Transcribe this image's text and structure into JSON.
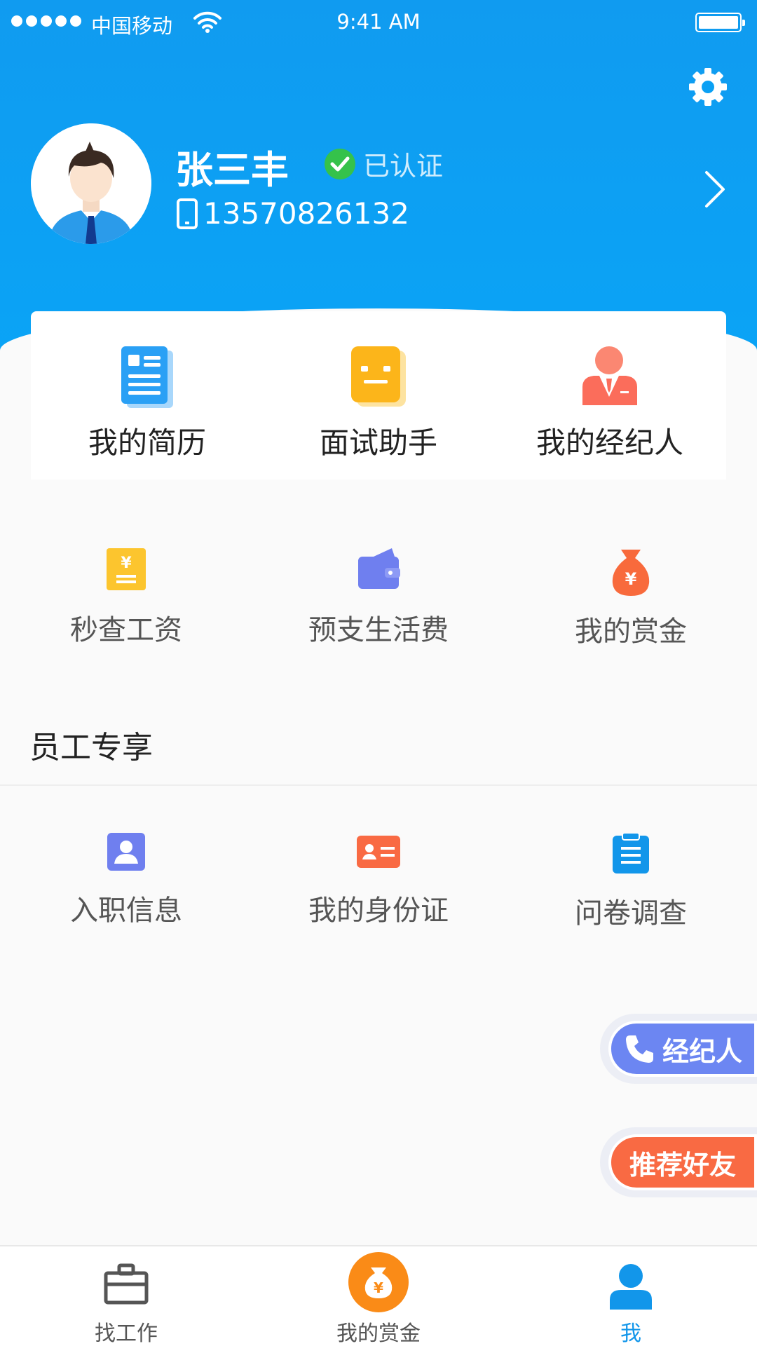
{
  "status_bar": {
    "carrier": "中国移动",
    "time": "9:41 AM"
  },
  "profile": {
    "name": "张三丰",
    "verified_label": "已认证",
    "phone": "13570826132"
  },
  "main_grid": [
    {
      "label": "我的简历",
      "icon": "resume-icon"
    },
    {
      "label": "面试助手",
      "icon": "interview-assistant-icon"
    },
    {
      "label": "我的经纪人",
      "icon": "agent-icon"
    },
    {
      "label": "秒查工资",
      "icon": "salary-icon"
    },
    {
      "label": "预支生活费",
      "icon": "wallet-icon"
    },
    {
      "label": "我的赏金",
      "icon": "money-bag-icon"
    }
  ],
  "employee_section": {
    "title": "员工专享",
    "items": [
      {
        "label": "入职信息",
        "icon": "onboarding-icon"
      },
      {
        "label": "我的身份证",
        "icon": "id-card-icon"
      },
      {
        "label": "问卷调查",
        "icon": "survey-icon"
      }
    ]
  },
  "floating_buttons": {
    "broker": "经纪人",
    "recommend": "推荐好友"
  },
  "tabbar": {
    "items": [
      {
        "label": "找工作",
        "icon": "briefcase-icon"
      },
      {
        "label": "我的赏金",
        "icon": "bounty-icon"
      },
      {
        "label": "我",
        "icon": "user-icon"
      }
    ],
    "active": "我"
  },
  "colors": {
    "header_blue": "#109bf0",
    "verified_green": "#35c24b",
    "tab_active": "#1296ea",
    "broker_button": "#6c86f2",
    "recommend_button": "#f96a43",
    "bounty_orange": "#fa8b17"
  }
}
